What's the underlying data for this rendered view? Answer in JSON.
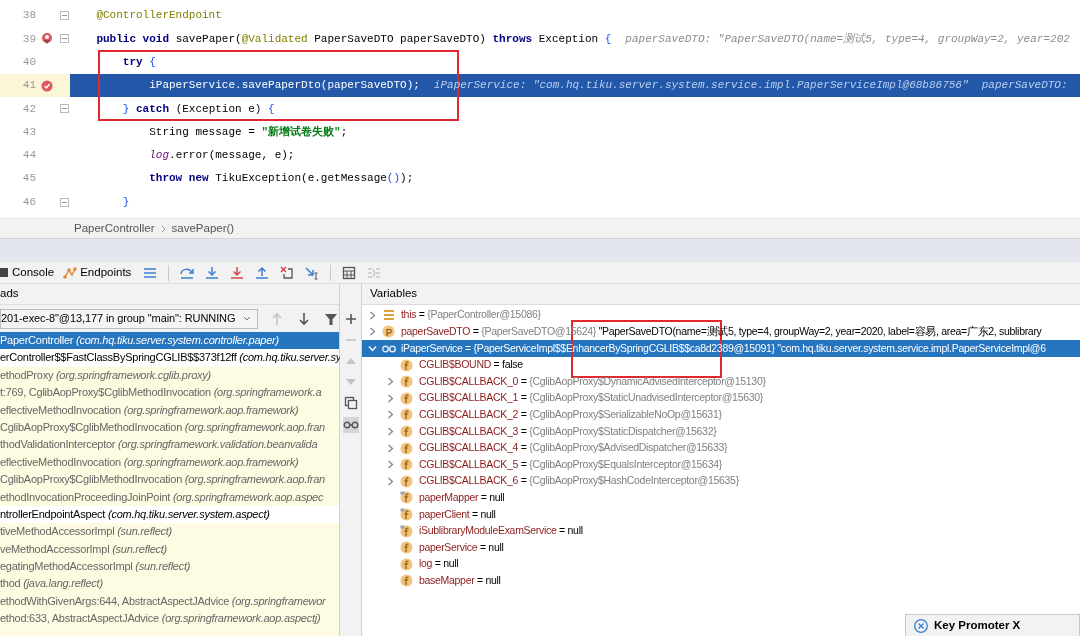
{
  "editor": {
    "lines": [
      {
        "number": "38",
        "fold": true,
        "kind": "code",
        "current": false,
        "segments": [
          {
            "kind": "annotation",
            "text": "    @ControllerEndpoint"
          }
        ]
      },
      {
        "number": "39",
        "fold": true,
        "kind": "method-breakpoint",
        "current": false,
        "segments": [
          {
            "kind": "keyword",
            "text": "    public void"
          },
          {
            "kind": "plain",
            "text": " savePaper("
          },
          {
            "kind": "annotation",
            "text": "@Validated"
          },
          {
            "kind": "plain",
            "text": " PaperSaveDTO paperSaveDTO) "
          },
          {
            "kind": "keyword",
            "text": "throws"
          },
          {
            "kind": "plain",
            "text": " Exception "
          },
          {
            "kind": "brace",
            "text": "{"
          }
        ],
        "hint": "paperSaveDTO: \"PaperSaveDTO(name=测试5, type=4, groupWay=2, year=202"
      },
      {
        "number": "40",
        "fold": false,
        "kind": "code",
        "current": false,
        "segments": [
          {
            "kind": "keyword",
            "text": "        try"
          },
          {
            "kind": "brace",
            "text": " {"
          }
        ]
      },
      {
        "number": "41",
        "fold": false,
        "kind": "breakpoint",
        "current": true,
        "segments": [
          {
            "kind": "plain",
            "text": "            iPaperService.savePaperDto(paperSaveDTO);"
          }
        ],
        "hint": "iPaperService: \"com.hq.tiku.server.system.service.impl.PaperServiceImpl@68b86756\"  paperSaveDTO:"
      },
      {
        "number": "42",
        "fold": true,
        "kind": "code",
        "current": false,
        "segments": [
          {
            "kind": "brace",
            "text": "        }"
          },
          {
            "kind": "keyword",
            "text": " catch"
          },
          {
            "kind": "plain",
            "text": " (Exception e) "
          },
          {
            "kind": "brace",
            "text": "{"
          }
        ]
      },
      {
        "number": "43",
        "fold": false,
        "kind": "code",
        "current": false,
        "segments": [
          {
            "kind": "plain",
            "text": "            String message = "
          },
          {
            "kind": "string",
            "text": "\"新增试卷失败\""
          },
          {
            "kind": "plain",
            "text": ";"
          }
        ]
      },
      {
        "number": "44",
        "fold": false,
        "kind": "code",
        "current": false,
        "segments": [
          {
            "kind": "static",
            "text": "            log"
          },
          {
            "kind": "plain",
            "text": ".error(message, e);"
          }
        ]
      },
      {
        "number": "45",
        "fold": false,
        "kind": "code",
        "current": false,
        "segments": [
          {
            "kind": "keyword",
            "text": "            throw new"
          },
          {
            "kind": "plain",
            "text": " TikuException(e.getMessage"
          },
          {
            "kind": "brace",
            "text": "()"
          },
          {
            "kind": "plain",
            "text": ");"
          }
        ]
      },
      {
        "number": "46",
        "fold": true,
        "kind": "code",
        "current": false,
        "segments": [
          {
            "kind": "brace",
            "text": "        }"
          }
        ]
      }
    ]
  },
  "breadcrumb": [
    "PaperController",
    "savePaper()"
  ],
  "toolbar": {
    "tabs": [
      {
        "label": "Console"
      },
      {
        "label": "Endpoints"
      }
    ],
    "actions": [
      {
        "kind": "layout",
        "disabled": false
      },
      {
        "kind": "separator"
      },
      {
        "kind": "step-over",
        "disabled": false
      },
      {
        "kind": "step-into",
        "disabled": false
      },
      {
        "kind": "force-step-into",
        "disabled": false
      },
      {
        "kind": "step-out",
        "disabled": false
      },
      {
        "kind": "drop-frame",
        "disabled": false
      },
      {
        "kind": "run-to-cursor",
        "disabled": false
      },
      {
        "kind": "separator"
      },
      {
        "kind": "evaluate",
        "disabled": false
      },
      {
        "kind": "trace",
        "disabled": true
      }
    ]
  },
  "threads": {
    "title": "ads",
    "selector": {
      "value": "201-exec-8\"@13,177 in group \"main\": RUNNING"
    },
    "nav": [
      {
        "kind": "up",
        "disabled": true
      },
      {
        "kind": "down",
        "disabled": false
      },
      {
        "kind": "filter",
        "disabled": false
      }
    ],
    "frames": [
      {
        "text": "PaperController *(com.hq.tiku.server.system.controller.paper)*",
        "kind": "user",
        "selected": true
      },
      {
        "text": "erController$$FastClassBySpringCGLIB$$373f12ff *(com.hq.tiku.server.sy*",
        "kind": "user",
        "selected": false
      },
      {
        "text": "ethodProxy *(org.springframework.cglib.proxy)*",
        "kind": "library",
        "selected": false
      },
      {
        "text": "t:769, CglibAopProxy$CglibMethodInvocation *(org.springframework.a*",
        "kind": "library",
        "selected": false
      },
      {
        "text": "eflectiveMethodInvocation *(org.springframework.aop.framework)*",
        "kind": "library",
        "selected": false
      },
      {
        "text": "CglibAopProxy$CglibMethodInvocation *(org.springframework.aop.fran*",
        "kind": "library",
        "selected": false
      },
      {
        "text": "thodValidationInterceptor *(org.springframework.validation.beanvalida*",
        "kind": "library",
        "selected": false
      },
      {
        "text": "eflectiveMethodInvocation *(org.springframework.aop.framework)*",
        "kind": "library",
        "selected": false
      },
      {
        "text": "CglibAopProxy$CglibMethodInvocation *(org.springframework.aop.fran*",
        "kind": "library",
        "selected": false
      },
      {
        "text": "ethodInvocationProceedingJoinPoint *(org.springframework.aop.aspec*",
        "kind": "library",
        "selected": false
      },
      {
        "text": "ntrollerEndpointAspect *(com.hq.tiku.server.system.aspect)*",
        "kind": "user",
        "selected": false
      },
      {
        "text": "tiveMethodAccessorImpl *(sun.reflect)*",
        "kind": "library",
        "selected": false
      },
      {
        "text": "veMethodAccessorImpl *(sun.reflect)*",
        "kind": "library",
        "selected": false
      },
      {
        "text": "egatingMethodAccessorImpl *(sun.reflect)*",
        "kind": "library",
        "selected": false
      },
      {
        "text": "thod *(java.lang.reflect)*",
        "kind": "library",
        "selected": false
      },
      {
        "text": "ethodWithGivenArgs:644, AbstractAspectJAdvice *(org.springframewor*",
        "kind": "library",
        "selected": false
      },
      {
        "text": "ethod:633, AbstractAspectJAdvice *(org.springframework.aop.aspectj)*",
        "kind": "library",
        "selected": false
      }
    ]
  },
  "side_toolbar": [
    {
      "kind": "add",
      "disabled": false
    },
    {
      "kind": "remove",
      "disabled": true
    },
    {
      "kind": "up",
      "disabled": true
    },
    {
      "kind": "down",
      "disabled": true
    },
    {
      "kind": "copy",
      "disabled": false
    },
    {
      "kind": "glasses",
      "disabled": false,
      "on": true
    }
  ],
  "variables": {
    "title": "Variables",
    "items": [
      {
        "kind": "this",
        "name": "this",
        "op": "=",
        "value": "{PaperController@15086}",
        "has_children": true,
        "expanded": false,
        "selected": false
      },
      {
        "kind": "parameter",
        "name": "paperSaveDTO",
        "op": "=",
        "value": "{PaperSaveDTO@15624}",
        "text": "\"PaperSaveDTO(name=测试5, type=4, groupWay=2, year=2020, label=容易, area=广东2, sublibrary",
        "has_children": true,
        "expanded": false,
        "selected": false
      },
      {
        "kind": "watch",
        "name": "iPaperService",
        "op": "=",
        "value": "{PaperServiceImpl$$EnhancerBySpringCGLIB$$ca8d2389@15091}",
        "text": "\"com.hq.tiku.server.system.service.impl.PaperServiceImpl@6",
        "has_children": true,
        "expanded": true,
        "selected": true,
        "children": [
          {
            "kind": "field",
            "name": "CGLIB$BOUND",
            "op": "=",
            "value": "false",
            "has_children": false,
            "selected": false
          },
          {
            "kind": "field",
            "name": "CGLIB$CALLBACK_0",
            "op": "=",
            "value": "{CglibAopProxy$DynamicAdvisedInterceptor@15130}",
            "has_children": true,
            "expanded": false,
            "selected": false
          },
          {
            "kind": "field",
            "name": "CGLIB$CALLBACK_1",
            "op": "=",
            "value": "{CglibAopProxy$StaticUnadvisedInterceptor@15630}",
            "has_children": true,
            "expanded": false,
            "selected": false
          },
          {
            "kind": "field",
            "name": "CGLIB$CALLBACK_2",
            "op": "=",
            "value": "{CglibAopProxy$SerializableNoOp@15631}",
            "has_children": true,
            "expanded": false,
            "selected": false
          },
          {
            "kind": "field",
            "name": "CGLIB$CALLBACK_3",
            "op": "=",
            "value": "{CglibAopProxy$StaticDispatcher@15632}",
            "has_children": true,
            "expanded": false,
            "selected": false
          },
          {
            "kind": "field",
            "name": "CGLIB$CALLBACK_4",
            "op": "=",
            "value": "{CglibAopProxy$AdvisedDispatcher@15633}",
            "has_children": true,
            "expanded": false,
            "selected": false
          },
          {
            "kind": "field",
            "name": "CGLIB$CALLBACK_5",
            "op": "=",
            "value": "{CglibAopProxy$EqualsInterceptor@15634}",
            "has_children": true,
            "expanded": false,
            "selected": false
          },
          {
            "kind": "field",
            "name": "CGLIB$CALLBACK_6",
            "op": "=",
            "value": "{CglibAopProxy$HashCodeInterceptor@15635}",
            "has_children": true,
            "expanded": false,
            "selected": false
          },
          {
            "kind": "field-tagged",
            "name": "paperMapper",
            "op": "=",
            "value": "null",
            "has_children": false,
            "selected": false
          },
          {
            "kind": "field-tagged",
            "name": "paperClient",
            "op": "=",
            "value": "null",
            "has_children": false,
            "selected": false
          },
          {
            "kind": "field-tagged",
            "name": "iSublibraryModuleExamService",
            "op": "=",
            "value": "null",
            "has_children": false,
            "selected": false
          },
          {
            "kind": "field",
            "name": "paperService",
            "op": "=",
            "value": "null",
            "has_children": false,
            "selected": false
          },
          {
            "kind": "field",
            "name": "log",
            "op": "=",
            "value": "null",
            "has_children": false,
            "selected": false
          },
          {
            "kind": "field",
            "name": "baseMapper",
            "op": "=",
            "value": "null",
            "has_children": false,
            "selected": false
          }
        ]
      }
    ]
  },
  "popup": {
    "title": "Key Promoter X"
  }
}
